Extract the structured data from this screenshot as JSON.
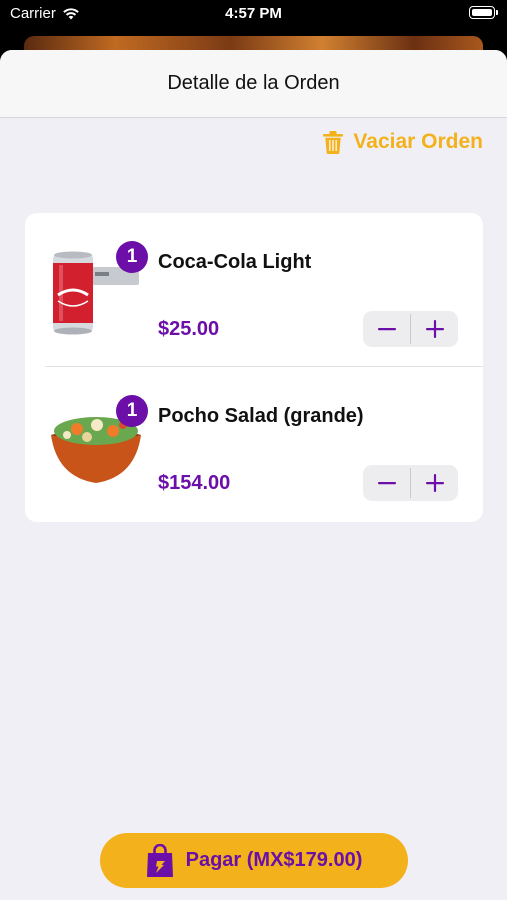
{
  "status_bar": {
    "carrier": "Carrier",
    "time": "4:57 PM"
  },
  "header": {
    "title": "Detalle de la Orden"
  },
  "actions": {
    "clear_order_label": "Vaciar Orden",
    "clear_order_icon": "trash-icon"
  },
  "order_items": [
    {
      "name": "Coca-Cola Light",
      "quantity": "1",
      "price": "$25.00",
      "image": "soda-can-image",
      "decrement_icon": "minus-icon",
      "increment_icon": "plus-icon"
    },
    {
      "name": "Pocho Salad (grande)",
      "quantity": "1",
      "price": "$154.00",
      "image": "salad-bowl-image",
      "decrement_icon": "minus-icon",
      "increment_icon": "plus-icon"
    }
  ],
  "checkout": {
    "pay_label": "Pagar (MX$179.00)",
    "pay_icon": "shopping-bag-icon"
  },
  "colors": {
    "accent_yellow": "#f3b21c",
    "accent_purple": "#6b0fa8",
    "sheet_background": "#f0eff5"
  }
}
